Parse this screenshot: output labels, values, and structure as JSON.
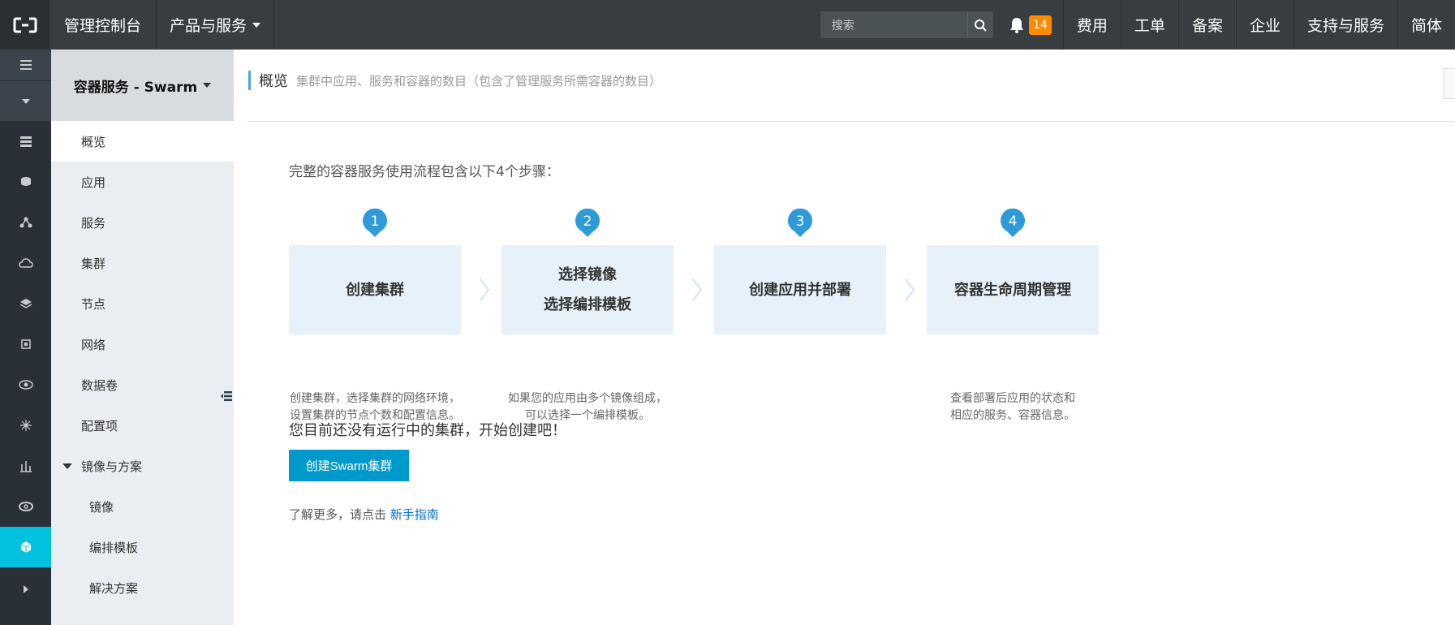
{
  "topbar": {
    "console_label": "管理控制台",
    "products_label": "产品与服务",
    "search_placeholder": "搜索",
    "notification_count": "14",
    "links": [
      "费用",
      "工单",
      "备案",
      "企业",
      "支持与服务",
      "简体"
    ]
  },
  "rail": {
    "icons": [
      "server-icon",
      "cloud-db-icon",
      "network-icon",
      "cloud-icon",
      "layers-icon",
      "chip-icon",
      "eye-icon",
      "nodes-icon",
      "chart-icon",
      "ring-icon",
      "container-icon"
    ],
    "active_index": 10
  },
  "sidebar": {
    "title": "容器服务 - Swarm",
    "items": [
      {
        "label": "概览",
        "active": true
      },
      {
        "label": "应用"
      },
      {
        "label": "服务"
      },
      {
        "label": "集群"
      },
      {
        "label": "节点"
      },
      {
        "label": "网络"
      },
      {
        "label": "数据卷"
      },
      {
        "label": "配置项"
      }
    ],
    "group": {
      "label": "镜像与方案",
      "children": [
        "镜像",
        "编排模板",
        "解决方案"
      ]
    }
  },
  "main": {
    "title": "概览",
    "description": "集群中应用、服务和容器的数目（包含了管理服务所需容器的数目）",
    "intro": "完整的容器服务使用流程包含以下4个步骤：",
    "steps": [
      {
        "num": "1",
        "line1": "创建集群",
        "line2": "",
        "desc1": "创建集群，选择集群的网络环境，",
        "desc2": "设置集群的节点个数和配置信息。"
      },
      {
        "num": "2",
        "line1": "选择镜像",
        "line2": "选择编排模板",
        "desc1": "如果您的应用由多个镜像组成，",
        "desc2": "可以选择一个编排模板。"
      },
      {
        "num": "3",
        "line1": "创建应用并部署",
        "line2": "",
        "desc1": "",
        "desc2": ""
      },
      {
        "num": "4",
        "line1": "容器生命周期管理",
        "line2": "",
        "desc1": "查看部署后应用的状态和",
        "desc2": "相应的服务、容器信息。"
      }
    ],
    "empty_message": "您目前还没有运行中的集群，开始创建吧！",
    "create_button": "创建Swarm集群",
    "learn_more": "了解更多，请点击",
    "guide_link": "新手指南"
  },
  "colors": {
    "topbar": "#373d41",
    "rail": "#293038",
    "accent": "#00c1de",
    "button": "#0099cc",
    "step_box": "#e6f1f9",
    "badge": "#ff8a00"
  }
}
